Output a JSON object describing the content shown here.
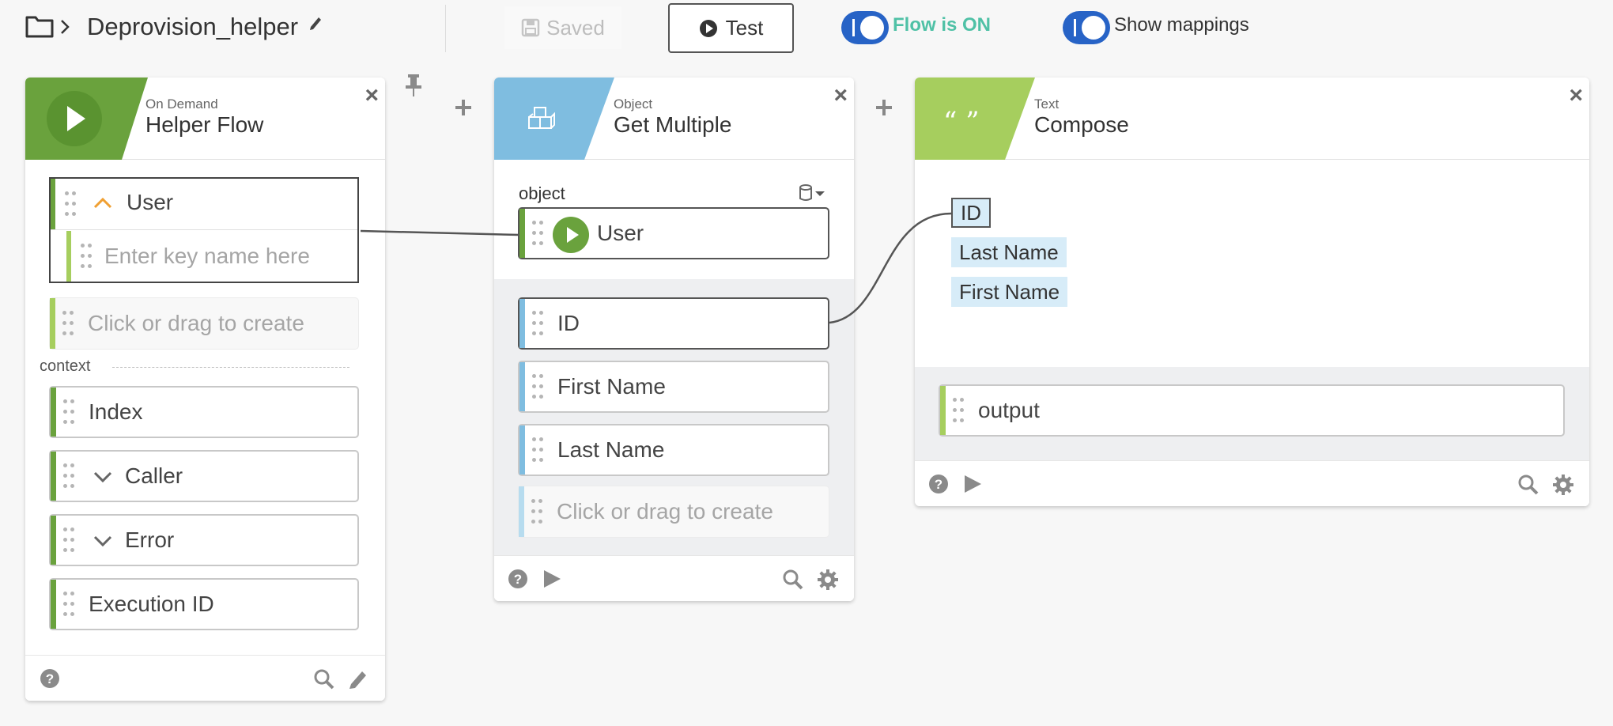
{
  "header": {
    "flow_name": "Deprovision_helper",
    "saved_label": "Saved",
    "test_label": "Test",
    "flow_toggle_label": "Flow is ON",
    "mappings_toggle_label": "Show mappings",
    "flow_on": true,
    "mappings_on": true
  },
  "colors": {
    "green": "#6aa23d",
    "light_green": "#a6ce5e",
    "blue": "#7fbde0",
    "toggle_blue": "#2763c6",
    "flow_on_text": "#4fc1a6"
  },
  "helper_card": {
    "kind": "On Demand",
    "title": "Helper Flow",
    "user_field": "User",
    "key_placeholder": "Enter key name here",
    "create_placeholder": "Click or drag to create",
    "context_label": "context",
    "context_fields": [
      "Index",
      "Caller",
      "Error",
      "Execution ID"
    ]
  },
  "object_card": {
    "kind": "Object",
    "title": "Get Multiple",
    "object_label": "object",
    "object_input": "User",
    "output_fields": [
      "ID",
      "First Name",
      "Last Name"
    ],
    "create_placeholder": "Click or drag to create"
  },
  "text_card": {
    "kind": "Text",
    "title": "Compose",
    "badge_glyph": "“ ”",
    "tokens": [
      "ID",
      "Last Name",
      "First Name"
    ],
    "output_field": "output"
  },
  "icons": [
    "folder-icon",
    "chevron-right-icon",
    "pencil-icon",
    "save-icon",
    "play-circle-icon",
    "pin-icon",
    "plus-icon",
    "close-icon",
    "cube-icon",
    "database-icon",
    "help-icon",
    "play-icon",
    "search-icon",
    "gear-icon",
    "chevron-up-icon",
    "chevron-down-icon"
  ]
}
